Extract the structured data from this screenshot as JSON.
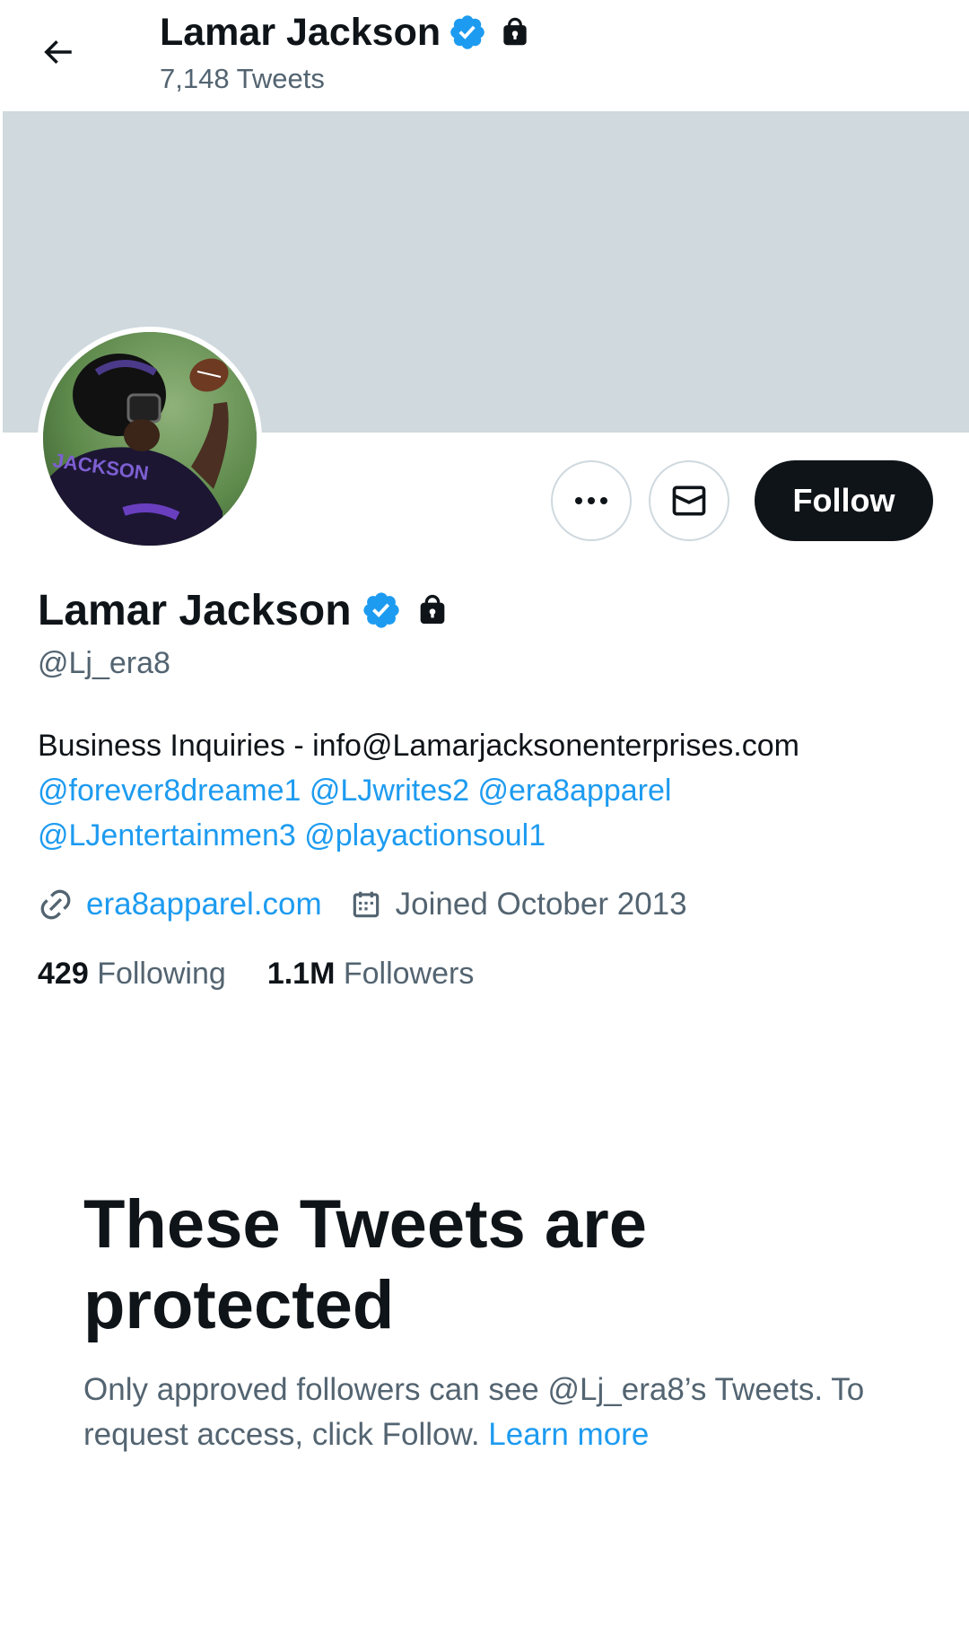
{
  "header": {
    "title": "Lamar Jackson",
    "tweet_count": "7,148 Tweets"
  },
  "profile": {
    "name": "Lamar Jackson",
    "handle": "@Lj_era8",
    "bio_text": "Business Inquiries - info@Lamarjacksonenterprises.com",
    "bio_mentions": [
      "@forever8dreame1",
      "@LJwrites2",
      "@era8apparel",
      "@LJentertainmen3",
      "@playactionsoul1"
    ],
    "website": "era8apparel.com",
    "joined": "Joined October 2013",
    "following_count": "429",
    "following_label": "Following",
    "followers_count": "1.1M",
    "followers_label": "Followers"
  },
  "actions": {
    "follow_label": "Follow"
  },
  "protected": {
    "title": "These Tweets are protected",
    "message": "Only approved followers can see @Lj_era8’s Tweets. To request access, click Follow.",
    "learn_more": "Learn more"
  },
  "icons": {
    "back": "arrow-left-icon",
    "verified": "verified-badge-icon",
    "lock": "lock-icon",
    "more": "more-icon",
    "message": "envelope-icon",
    "link": "link-icon",
    "calendar": "calendar-icon"
  },
  "colors": {
    "accent": "#1d9bf0",
    "text": "#0f1419",
    "secondary": "#536471",
    "banner": "#cfd9de",
    "follow_button": "#0f1419"
  }
}
